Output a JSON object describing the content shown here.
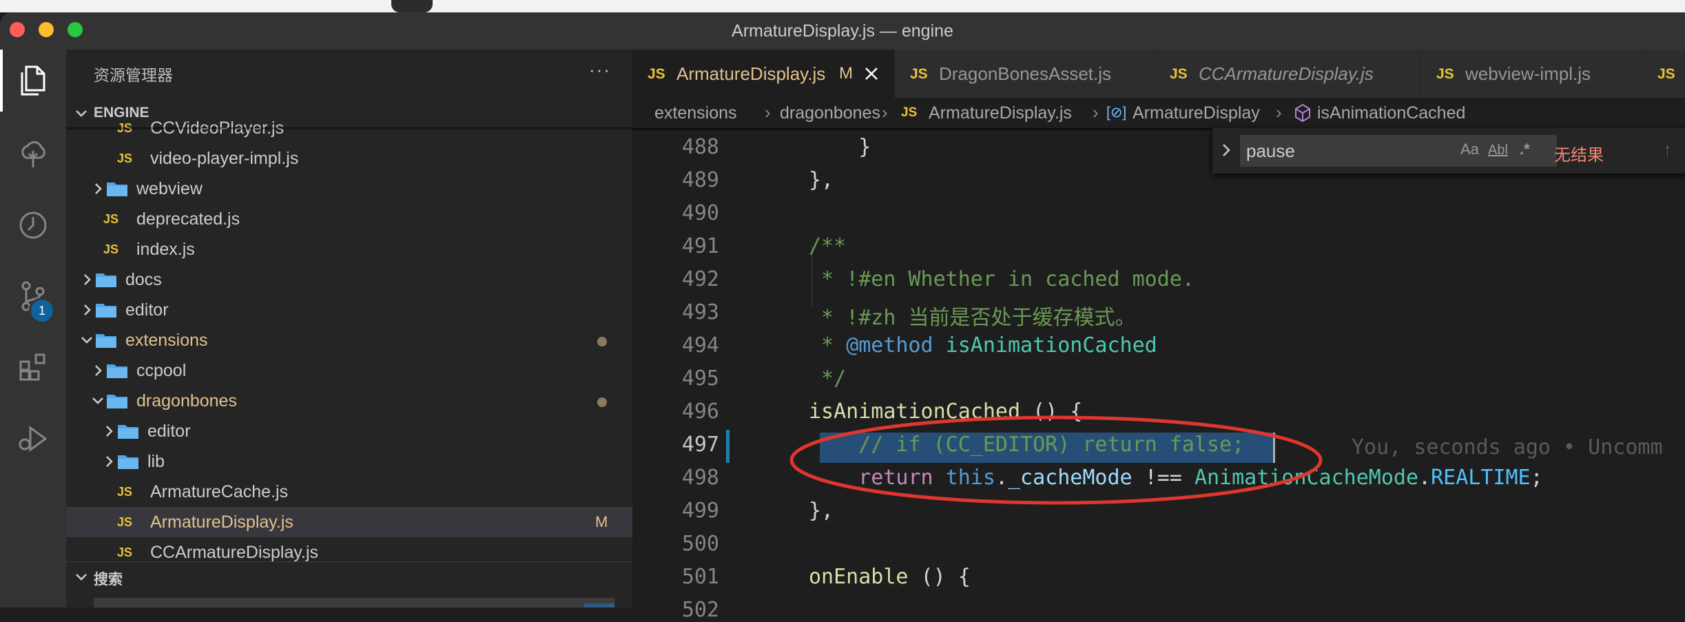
{
  "window": {
    "title": "ArmatureDisplay.js — engine"
  },
  "activity_bar": {
    "items": [
      {
        "icon": "files-icon"
      },
      {
        "icon": "cloud-tree-icon"
      },
      {
        "icon": "timeline-icon"
      },
      {
        "icon": "source-control-icon",
        "badge": "1"
      },
      {
        "icon": "extensions-icon"
      },
      {
        "icon": "run-debug-icon"
      }
    ]
  },
  "explorer": {
    "title": "资源管理器",
    "more": "···",
    "section": "ENGINE",
    "tree": [
      {
        "label": "CCVideoPlayer.js",
        "type": "js"
      },
      {
        "label": "video-player-impl.js",
        "type": "js"
      },
      {
        "label": "webview",
        "type": "folder",
        "state": "collapsed"
      },
      {
        "label": "deprecated.js",
        "type": "js"
      },
      {
        "label": "index.js",
        "type": "js"
      },
      {
        "label": "docs",
        "type": "folder",
        "state": "collapsed"
      },
      {
        "label": "editor",
        "type": "folder",
        "state": "collapsed"
      },
      {
        "label": "extensions",
        "type": "folder",
        "state": "expanded",
        "modified": true
      },
      {
        "label": "ccpool",
        "type": "folder",
        "state": "collapsed"
      },
      {
        "label": "dragonbones",
        "type": "folder",
        "state": "expanded",
        "modified": true
      },
      {
        "label": "editor",
        "type": "folder",
        "state": "collapsed"
      },
      {
        "label": "lib",
        "type": "folder",
        "state": "collapsed"
      },
      {
        "label": "ArmatureCache.js",
        "type": "js"
      },
      {
        "label": "ArmatureDisplay.js",
        "type": "js",
        "status": "M",
        "selected": true
      },
      {
        "label": "CCArmatureDisplay.js",
        "type": "js"
      }
    ],
    "search_section": "搜索"
  },
  "tabs": [
    {
      "label": "ArmatureDisplay.js",
      "lang": "JS",
      "status": "M",
      "active": true
    },
    {
      "label": "DragonBonesAsset.js",
      "lang": "JS"
    },
    {
      "label": "CCArmatureDisplay.js",
      "lang": "JS",
      "preview": true
    },
    {
      "label": "webview-impl.js",
      "lang": "JS"
    },
    {
      "label": "",
      "lang": "JS"
    }
  ],
  "breadcrumb": [
    "extensions",
    "dragonbones",
    "ArmatureDisplay.js",
    "ArmatureDisplay",
    "isAnimationCached"
  ],
  "find": {
    "query": "pause",
    "match_case": "Aa",
    "whole_word": "Abl",
    "regex": ".*",
    "result": "无结果"
  },
  "editor": {
    "lines": [
      {
        "n": "488",
        "text": "    }"
      },
      {
        "n": "489",
        "text": "},"
      },
      {
        "n": "490",
        "text": ""
      },
      {
        "n": "491",
        "text": "/**"
      },
      {
        "n": "492",
        "text": " * !#en Whether in cached mode."
      },
      {
        "n": "493",
        "text": " * !#zh 当前是否处于缓存模式。"
      },
      {
        "n": "494",
        "text": " * @method isAnimationCached"
      },
      {
        "n": "495",
        "text": " */"
      },
      {
        "n": "496",
        "text": "isAnimationCached () {"
      },
      {
        "n": "497",
        "text": "    // if (CC_EDITOR) return false;"
      },
      {
        "n": "498",
        "text": "    return this._cacheMode !== AnimationCacheMode.REALTIME;"
      },
      {
        "n": "499",
        "text": "},"
      },
      {
        "n": "500",
        "text": ""
      },
      {
        "n": "501",
        "text": "onEnable () {"
      },
      {
        "n": "502",
        "text": ""
      }
    ],
    "blame": "You, seconds ago • Uncomm"
  },
  "colors": {
    "accent_badge": "#0e639c",
    "highlight_ring": "#e0362e",
    "modified": "#e2c08d"
  }
}
